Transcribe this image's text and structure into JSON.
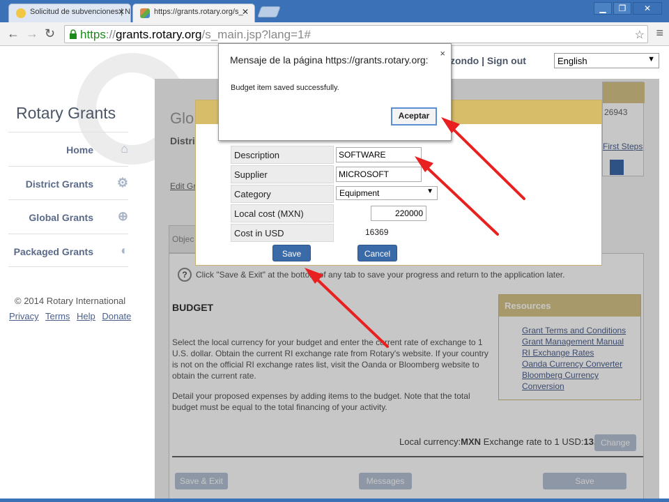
{
  "browser": {
    "tabs": [
      {
        "title": "Solicitud de subvenciones | N"
      },
      {
        "title": "https://grants.rotary.org/s_"
      }
    ],
    "window_buttons": {
      "minimize": "▁",
      "restore": "❐",
      "close": "✕"
    },
    "url": {
      "scheme": "https",
      "sep": "://",
      "host": "grants.rotary.org",
      "path": "/s_main.jsp?lang=1#"
    }
  },
  "sidebar": {
    "brand": "Rotary Grants",
    "nav": [
      {
        "label": "Home",
        "icon": "home-icon"
      },
      {
        "label": "District Grants",
        "icon": "gear-icon"
      },
      {
        "label": "Global Grants",
        "icon": "globe-icon"
      },
      {
        "label": "Packaged Grants",
        "icon": "cycle-icon"
      }
    ],
    "copyright": "© 2014 Rotary International",
    "links": [
      "Privacy",
      "Terms",
      "Help",
      "Donate"
    ]
  },
  "header": {
    "user_fragment": "zondo",
    "sep": "|",
    "signout": "Sign out",
    "language": "English"
  },
  "background": {
    "title_fragment": "Glo",
    "distr_fragment": "Distri",
    "number_fragment": "26943",
    "edit_fragment": "Edit Gr",
    "first_steps": "First Steps",
    "obj_tab": "Objec",
    "hint": "Click \"Save & Exit\" at the bottom of any tab to save your progress and return to the application later.",
    "budget_heading": "BUDGET",
    "para1": "Select the local currency for your budget and enter the current rate of exchange to 1 U.S. dollar. Obtain the current RI exchange rate from Rotary's website. If your country is not on the official RI exchange rates list, visit the Oanda or Bloomberg website to obtain the current rate.",
    "para2": "Detail your proposed expenses by adding items to the budget. Note that the total budget must be equal to the total financing of your activity.",
    "resources": {
      "title": "Resources",
      "links": [
        "Grant Terms and Conditions",
        "Grant Management Manual",
        "RI Exchange Rates",
        "Oanda Currency Converter",
        "Bloomberg Currency Conversion"
      ]
    },
    "rate": {
      "label1": "Local currency:",
      "currency": "MXN",
      "label2": " Exchange rate to 1 USD:",
      "value": "13.44"
    },
    "change_button": "Change",
    "save_exit": "Save & Exit",
    "messages": "Messages",
    "save": "Save"
  },
  "modal": {
    "fields": [
      {
        "label": "Description",
        "value": "SOFTWARE"
      },
      {
        "label": "Supplier",
        "value": "MICROSOFT"
      },
      {
        "label": "Category",
        "value": "Equipment"
      },
      {
        "label": "Local cost (MXN)",
        "value": "220000"
      },
      {
        "label": "Cost in USD",
        "value": "16369"
      }
    ],
    "save": "Save",
    "cancel": "Cancel"
  },
  "alert": {
    "title": "Mensaje de la página https://grants.rotary.org:",
    "close": "×",
    "message": "Budget item saved successfully.",
    "ok": "Aceptar"
  },
  "colors": {
    "accent": "#3a6aa8",
    "modal_header": "#d7bd6a",
    "arrow": "#e8201f"
  }
}
